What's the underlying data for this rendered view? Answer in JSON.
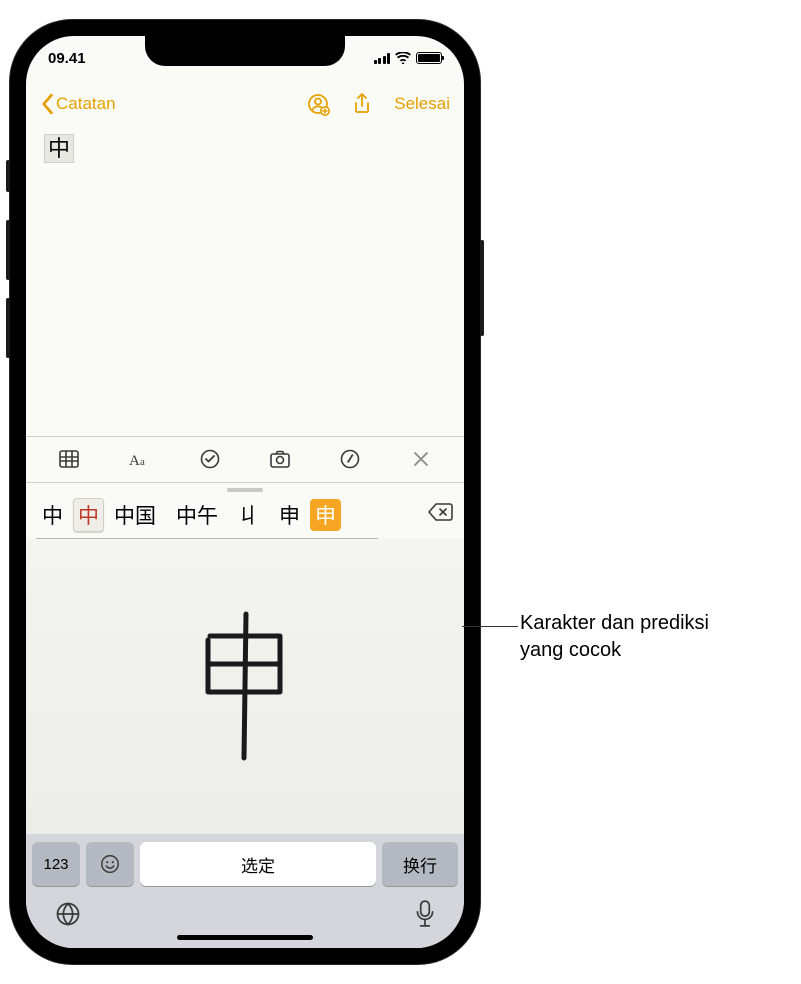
{
  "status": {
    "time": "09.41"
  },
  "nav": {
    "back": "Catatan",
    "done": "Selesai"
  },
  "note": {
    "typed_char": "中"
  },
  "candidates": {
    "items": [
      "中",
      "中",
      "中国",
      "中午",
      "丩",
      "申",
      "申"
    ]
  },
  "keys": {
    "numbers": "123",
    "space": "选定",
    "return_label": "换行"
  },
  "callout": {
    "line1": "Karakter dan prediksi",
    "line2": "yang cocok"
  }
}
